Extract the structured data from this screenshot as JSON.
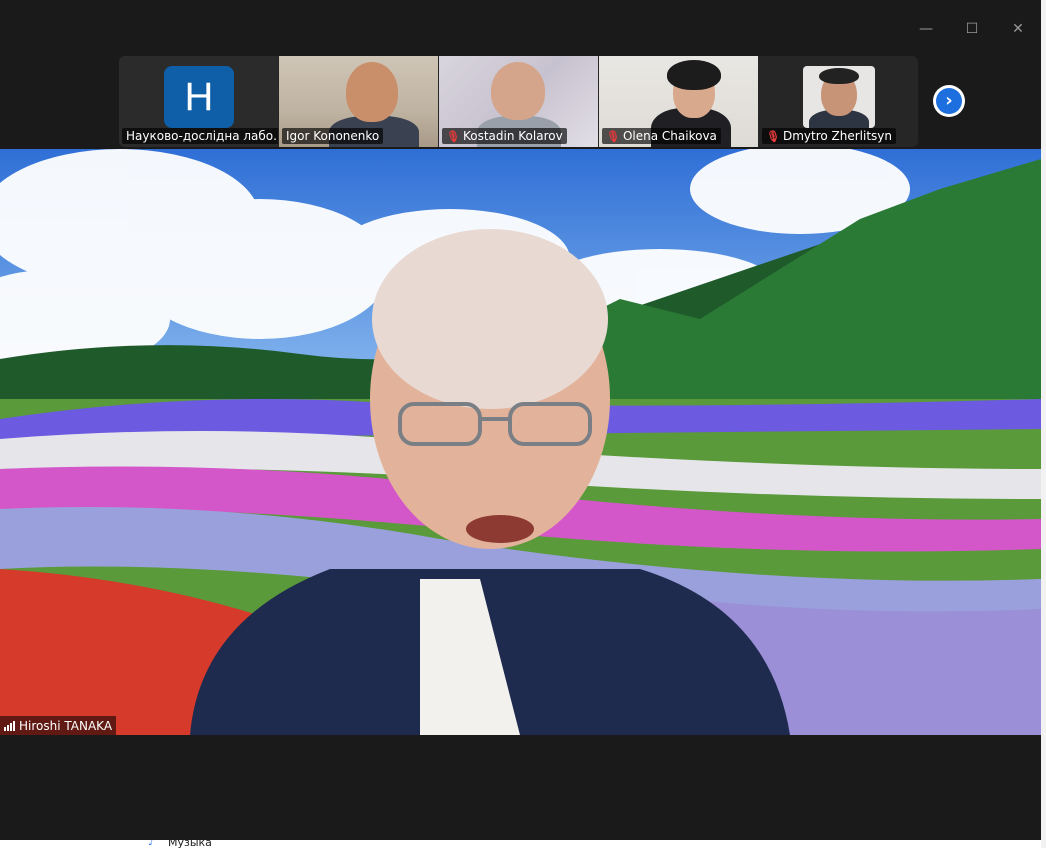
{
  "window": {
    "minimize_glyph": "—",
    "maximize_glyph": "☐",
    "close_glyph": "✕"
  },
  "gallery": {
    "participants": [
      {
        "name": "Науково-дослідна лабо...",
        "muted": false,
        "avatar_letter": "H",
        "avatar_color": "#0e5fa8"
      },
      {
        "name": "Igor Kononenko",
        "muted": false
      },
      {
        "name": "Kostadin Kolarov",
        "muted": true
      },
      {
        "name": "Olena Chaikova",
        "muted": true
      },
      {
        "name": "Dmytro Zherlitsyn",
        "muted": true
      }
    ],
    "next_page_icon": "chevron-right-icon",
    "next_glyph": "›"
  },
  "active_speaker": {
    "name": "Hiroshi TANAKA",
    "signal_icon": "signal-bars-icon"
  },
  "taskbar": {
    "item_label": "Музыка",
    "item_icon": "music-folder-icon"
  },
  "colors": {
    "zoom_bg": "#1a1a1a",
    "accent_blue": "#1d6fe0",
    "mute_red": "#e23b3b"
  }
}
